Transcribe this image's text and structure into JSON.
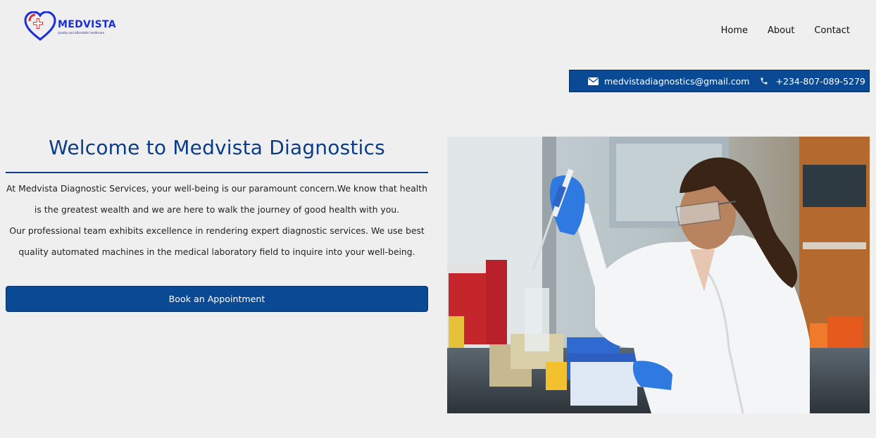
{
  "brand": {
    "name": "MEDVISTA",
    "tagline": "Quality and affordable healthcare",
    "colors": {
      "primary": "#0a4a94",
      "heading": "#0b3d86",
      "logo_red": "#e02b2b",
      "logo_blue": "#1a2fd6"
    }
  },
  "nav": {
    "items": [
      "Home",
      "About",
      "Contact"
    ]
  },
  "contact": {
    "email": "medvistadiagnostics@gmail.com",
    "phone": "+234-807-089-5279",
    "email_icon": "envelope-icon",
    "phone_icon": "phone-icon"
  },
  "hero": {
    "title": "Welcome to Medvista Diagnostics",
    "paragraph1": "At Medvista Diagnostic Services, your well-being is our paramount concern.We know that health is the greatest wealth and we are here to walk the journey of good health with you.",
    "paragraph2": "Our professional team exhibits excellence in rendering expert diagnostic services. We use best quality automated machines in the medical laboratory field to inquire into your well-being.",
    "button_label": "Book an Appointment"
  }
}
